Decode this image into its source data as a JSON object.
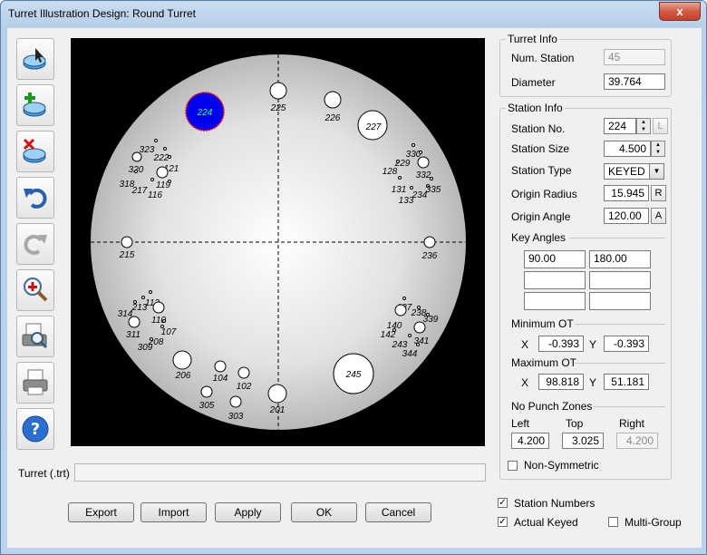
{
  "window": {
    "title": "Turret Illustration Design: Round Turret",
    "close_glyph": "x"
  },
  "toolbar": {
    "icons": [
      "select-station-icon",
      "add-station-icon",
      "delete-station-icon",
      "undo-icon",
      "redo-icon",
      "zoom-icon",
      "print-preview-icon",
      "print-icon",
      "help-icon"
    ]
  },
  "turret_info": {
    "legend": "Turret Info",
    "num_station_label": "Num. Station",
    "num_station_value": "45",
    "diameter_label": "Diameter",
    "diameter_value": "39.764"
  },
  "station_info": {
    "legend": "Station Info",
    "station_no_label": "Station No.",
    "station_no_value": "224",
    "station_no_btn": "L",
    "station_size_label": "Station Size",
    "station_size_value": "4.500",
    "station_type_label": "Station Type",
    "station_type_value": "KEYED",
    "origin_radius_label": "Origin Radius",
    "origin_radius_value": "15.945",
    "origin_radius_btn": "R",
    "origin_angle_label": "Origin Angle",
    "origin_angle_value": "120.00",
    "origin_angle_btn": "A",
    "key_angles_label": "Key Angles",
    "key_angles": [
      "90.00",
      "180.00",
      "",
      "",
      "",
      ""
    ],
    "min_ot_label": "Minimum OT",
    "min_ot_x": "-0.393",
    "min_ot_y": "-0.393",
    "max_ot_label": "Maximum OT",
    "max_ot_x": "98.818",
    "max_ot_y": "51.181",
    "x_label": "X",
    "y_label": "Y",
    "no_punch_label": "No Punch Zones",
    "left_label": "Left",
    "top_label": "Top",
    "right_label": "Right",
    "left_value": "4.200",
    "top_value": "3.025",
    "right_value": "4.200",
    "non_symmetric_label": "Non-Symmetric"
  },
  "turret_file": {
    "label": "Turret (.trt)",
    "value": ""
  },
  "options": {
    "station_numbers": "Station Numbers",
    "actual_keyed": "Actual Keyed",
    "multi_group": "Multi-Group"
  },
  "buttons": {
    "export": "Export",
    "import": "Import",
    "apply": "Apply",
    "ok": "OK",
    "cancel": "Cancel"
  },
  "colors": {
    "selected_fill": "#0000ee",
    "selected_outline": "#ff0000",
    "selected_text": "#33ff66"
  },
  "stations": [
    {
      "label": "224",
      "selected": true
    },
    {
      "label": "225"
    },
    {
      "label": "226"
    },
    {
      "label": "227"
    },
    {
      "label": "323"
    },
    {
      "label": "222"
    },
    {
      "label": "320"
    },
    {
      "label": "121"
    },
    {
      "label": "318"
    },
    {
      "label": "217"
    },
    {
      "label": "119"
    },
    {
      "label": "116"
    },
    {
      "label": "330"
    },
    {
      "label": "229"
    },
    {
      "label": "128"
    },
    {
      "label": "332"
    },
    {
      "label": "131"
    },
    {
      "label": "234"
    },
    {
      "label": "335"
    },
    {
      "label": "133"
    },
    {
      "label": "215"
    },
    {
      "label": "236"
    },
    {
      "label": "314"
    },
    {
      "label": "213"
    },
    {
      "label": "112"
    },
    {
      "label": "110"
    },
    {
      "label": "311"
    },
    {
      "label": "208"
    },
    {
      "label": "107"
    },
    {
      "label": "309"
    },
    {
      "label": "206"
    },
    {
      "label": "104"
    },
    {
      "label": "102"
    },
    {
      "label": "305"
    },
    {
      "label": "303"
    },
    {
      "label": "201"
    },
    {
      "label": "137"
    },
    {
      "label": "238"
    },
    {
      "label": "339"
    },
    {
      "label": "140"
    },
    {
      "label": "142"
    },
    {
      "label": "341"
    },
    {
      "label": "243"
    },
    {
      "label": "344"
    },
    {
      "label": "245"
    }
  ]
}
